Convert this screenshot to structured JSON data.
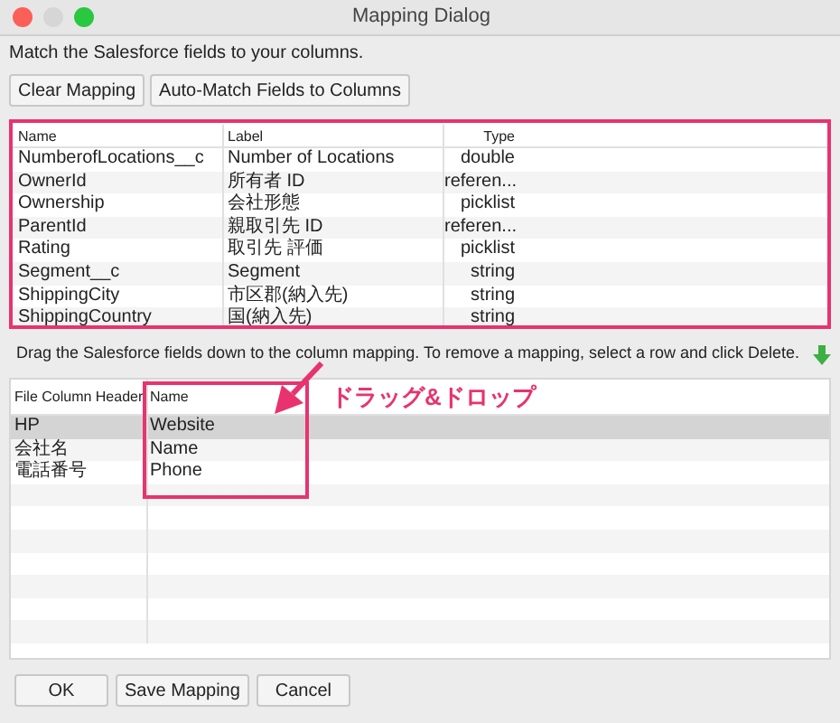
{
  "window": {
    "title": "Mapping Dialog"
  },
  "instruction": "Match the Salesforce fields to your columns.",
  "top_buttons": [
    "Clear Mapping",
    "Auto-Match Fields to Columns"
  ],
  "fields_table": {
    "columns": [
      "Name",
      "Label",
      "Type"
    ],
    "rows": [
      [
        "NumberofLocations__c",
        "Number of Locations",
        "double"
      ],
      [
        "OwnerId",
        "所有者 ID",
        "referen..."
      ],
      [
        "Ownership",
        "会社形態",
        "picklist"
      ],
      [
        "ParentId",
        "親取引先 ID",
        "referen..."
      ],
      [
        "Rating",
        "取引先 評価",
        "picklist"
      ],
      [
        "Segment__c",
        "Segment",
        "string"
      ],
      [
        "ShippingCity",
        "市区郡(納入先)",
        "string"
      ],
      [
        "ShippingCountry",
        "国(納入先)",
        "string"
      ]
    ]
  },
  "hint": "Drag the Salesforce fields down to the column mapping.  To remove a mapping, select a row and click Delete.",
  "mapping_table": {
    "columns": [
      "File Column Header",
      "Name"
    ],
    "rows": [
      {
        "cells": [
          "HP",
          "Website"
        ],
        "selected": true
      },
      {
        "cells": [
          "会社名",
          "Name"
        ],
        "selected": false
      },
      {
        "cells": [
          "電話番号",
          "Phone"
        ],
        "selected": false
      }
    ]
  },
  "annotation": "ドラッグ&ドロップ",
  "bottom_buttons": [
    "OK",
    "Save Mapping",
    "Cancel"
  ]
}
